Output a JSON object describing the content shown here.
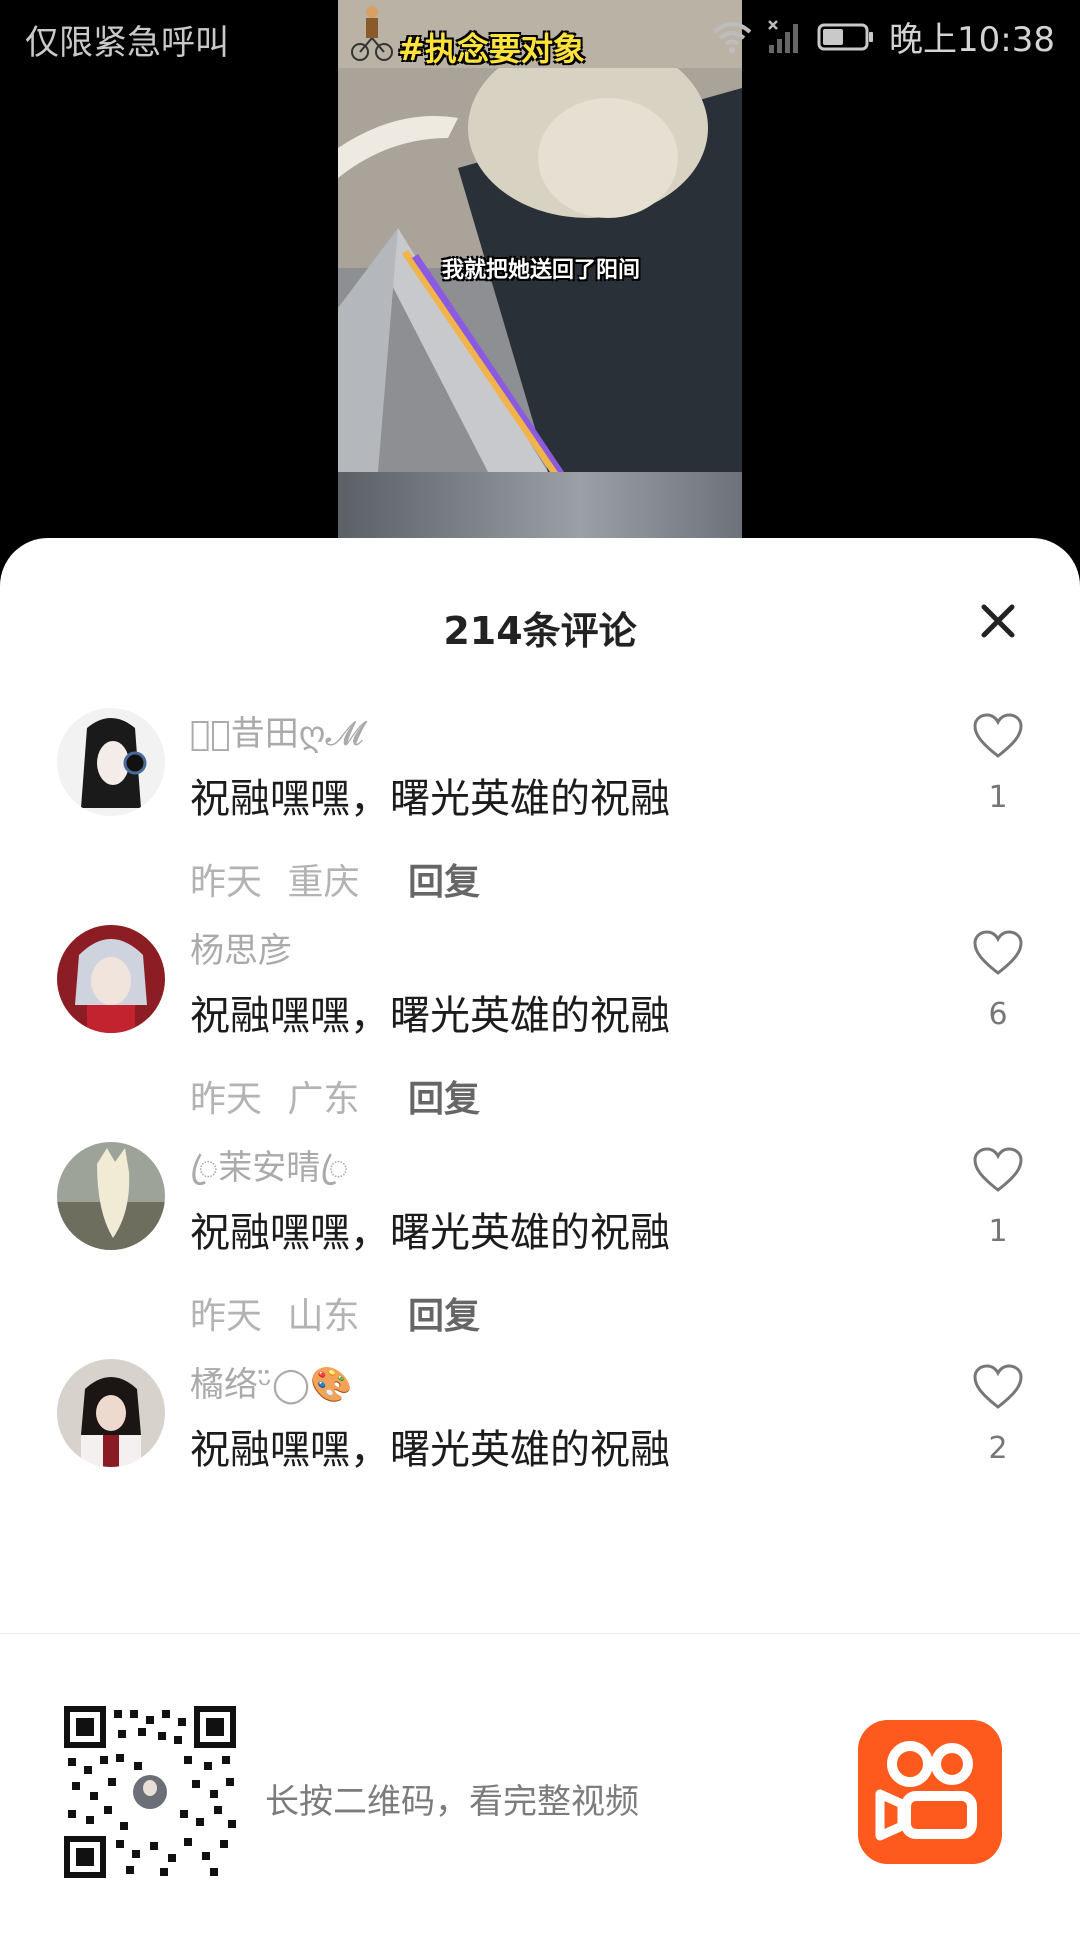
{
  "status_bar": {
    "left_text": "仅限紧急呼叫",
    "time": "晚上10:38",
    "icons": [
      "wifi-icon",
      "signal-icon",
      "battery-icon"
    ]
  },
  "video": {
    "hashtag": "#执念要对象",
    "caption": "我就把她送回了阳间"
  },
  "comments_panel": {
    "title": "214条评论",
    "close_icon": "close-icon",
    "comments": [
      {
        "username": "𝓜ꦿ昔田ღ𝓜",
        "text": "祝融嘿嘿，曙光英雄的祝融",
        "time": "昨天",
        "location": "重庆",
        "reply_label": "回复",
        "likes": "1"
      },
      {
        "username": "杨思彦",
        "text": "祝融嘿嘿，曙光英雄的祝融",
        "time": "昨天",
        "location": "广东",
        "reply_label": "回复",
        "likes": "6"
      },
      {
        "username": "ꦿ茉安晴ꦿ",
        "text": "祝融嘿嘿，曙光英雄的祝融",
        "time": "昨天",
        "location": "山东",
        "reply_label": "回复",
        "likes": "1"
      },
      {
        "username": "橘络ᵕ̈◯🎨",
        "text": "祝融嘿嘿，曙光英雄的祝融",
        "time": "",
        "location": "",
        "reply_label": "",
        "likes": "2"
      }
    ]
  },
  "footer": {
    "text": "长按二维码，看完整视频",
    "icons": [
      "qr-code",
      "kuaishou-logo"
    ]
  },
  "colors": {
    "brand_orange": "#fe5a1e",
    "muted_text": "#aaaaaa",
    "body_text": "#1c1c1c"
  }
}
